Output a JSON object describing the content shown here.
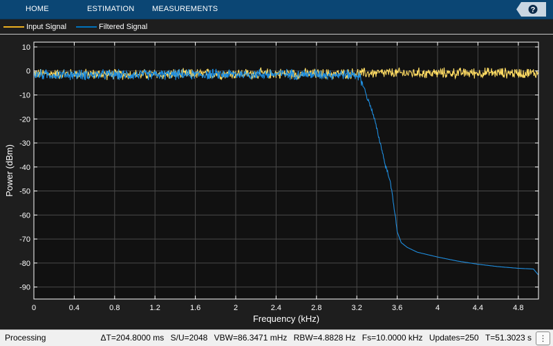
{
  "toolstrip": {
    "tabs": [
      {
        "label": "HOME"
      },
      {
        "label": "ESTIMATION"
      },
      {
        "label": "MEASUREMENTS"
      }
    ],
    "help_label": "?"
  },
  "legend": {
    "items": [
      {
        "label": "Input Signal",
        "color": "#edb120"
      },
      {
        "label": "Filtered Signal",
        "color": "#0072bd"
      }
    ]
  },
  "chart_data": {
    "type": "line",
    "xlabel": "Frequency (kHz)",
    "ylabel": "Power (dBm)",
    "xlim": [
      0,
      5
    ],
    "ylim": [
      -95,
      12
    ],
    "xticks": [
      0,
      0.4,
      0.8,
      1.2,
      1.6,
      2,
      2.4,
      2.8,
      3.2,
      3.6,
      4,
      4.4,
      4.8
    ],
    "xtick_labels": [
      "0",
      "0.4",
      "0.8",
      "1.2",
      "1.6",
      "2",
      "2.4",
      "2.8",
      "3.2",
      "3.6",
      "4",
      "4.4",
      "4.8"
    ],
    "yticks": [
      10,
      0,
      -10,
      -20,
      -30,
      -40,
      -50,
      -60,
      -70,
      -80,
      -90
    ],
    "ytick_labels": [
      "10",
      "0",
      "-10",
      "-20",
      "-30",
      "-40",
      "-50",
      "-60",
      "-70",
      "-80",
      "-90"
    ],
    "grid": true,
    "legend_position": "top",
    "colors": {
      "background": "#111111",
      "axes": "#ffffff",
      "grid": "#4a4a4a"
    },
    "series": [
      {
        "name": "Input Signal",
        "color": "#ffdc64",
        "noise_amplitude_db": 2.0,
        "x": [
          0,
          0.5,
          1.0,
          1.5,
          2.0,
          2.5,
          3.0,
          3.2,
          3.5,
          4.0,
          4.5,
          5.0
        ],
        "y": [
          -1.2,
          -1.3,
          -1.5,
          -1.3,
          -1.2,
          -1.1,
          -1.3,
          -1.0,
          -0.9,
          -0.9,
          -0.8,
          -0.9
        ]
      },
      {
        "name": "Filtered Signal",
        "color": "#1f8ee0",
        "noise_amplitude_db": 2.0,
        "noise_until_x": 3.25,
        "x": [
          0,
          0.5,
          1.0,
          1.5,
          2.0,
          2.5,
          3.0,
          3.2,
          3.24,
          3.28,
          3.3,
          3.34,
          3.38,
          3.42,
          3.45,
          3.48,
          3.52,
          3.55,
          3.58,
          3.6,
          3.64,
          3.7,
          3.8,
          4.0,
          4.2,
          4.4,
          4.6,
          4.8,
          4.95,
          5.0
        ],
        "y": [
          -1.5,
          -1.6,
          -1.6,
          -1.5,
          -1.4,
          -1.3,
          -1.5,
          -1.5,
          -3.5,
          -8,
          -11,
          -15,
          -21,
          -28,
          -33,
          -39,
          -44,
          -51,
          -60,
          -67,
          -71.5,
          -73.5,
          -75.5,
          -77.5,
          -79.2,
          -80.5,
          -81.5,
          -82.2,
          -82.5,
          -85
        ]
      }
    ]
  },
  "status": {
    "left": "Processing",
    "dt": "ΔT=204.8000 ms",
    "su": "S/U=2048",
    "vbw": "VBW=86.3471 mHz",
    "rbw": "RBW=4.8828 Hz",
    "fs": "Fs=10.0000 kHz",
    "updates": "Updates=250",
    "t": "T=51.3023 s",
    "menu_glyph": "⋮"
  }
}
